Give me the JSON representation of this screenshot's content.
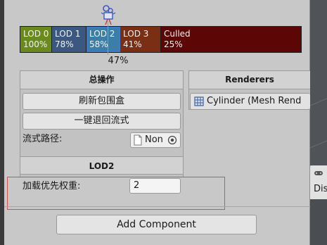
{
  "lod_group": {
    "levels": [
      {
        "name": "LOD 0",
        "percent": "100%",
        "color": "#6b8a1e"
      },
      {
        "name": "LOD 1",
        "percent": "78%",
        "color": "#3c5780"
      },
      {
        "name": "LOD 2",
        "percent": "58%",
        "color": "#3b7fa8"
      },
      {
        "name": "LOD 3",
        "percent": "41%",
        "color": "#7a2e14"
      },
      {
        "name": "Culled",
        "percent": "25%",
        "color": "#5c0606"
      }
    ],
    "camera_percent": "47%"
  },
  "left_panel": {
    "header": "总操作",
    "refresh_bounds_button": "刷新包围盒",
    "revert_button": "一键退回流式",
    "stream_path_label": "流式路径:",
    "stream_path_value": "Non",
    "lod_section_header": "LOD2",
    "load_priority_label": "加载优先权重:",
    "load_priority_value": "2"
  },
  "right_panel": {
    "header": "Renderers",
    "items": [
      "Cylinder (Mesh Rend"
    ]
  },
  "add_component_label": "Add Component",
  "side_card": {
    "label": "Dis"
  }
}
